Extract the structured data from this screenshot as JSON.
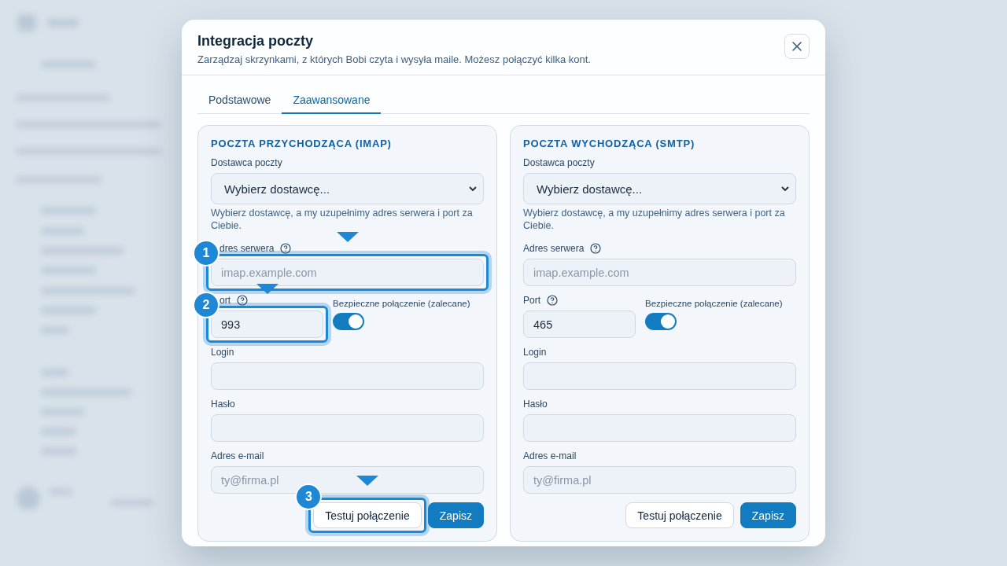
{
  "dialog": {
    "title": "Integracja poczty",
    "subtitle": "Zarządzaj skrzynkami, z których Bobi czyta i wysyła maile. Możesz połączyć kilka kont."
  },
  "tabs": [
    {
      "label": "Podstawowe",
      "selected": false
    },
    {
      "label": "Zaawansowane",
      "selected": true
    }
  ],
  "panels": [
    {
      "title": "POCZTA PRZYCHODZĄCA (IMAP)",
      "fields": [
        {
          "kind": "select",
          "label": "Dostawca poczty",
          "value": "Wybierz dostawcę...",
          "hint": "Wybierz dostawcę, a my uzupełnimy adres serwera i port za Ciebie."
        },
        {
          "kind": "input",
          "label": "dres serwera",
          "help": true,
          "placeholder": "imap.example.com",
          "tour_step": "1"
        },
        {
          "kind": "port",
          "label": "ort",
          "help": true,
          "value": "993",
          "tour_step": "2",
          "toggle": {
            "label": "Bezpieczne połączenie (zalecane)",
            "on": true
          }
        },
        {
          "kind": "input",
          "label": "Login",
          "help": false
        },
        {
          "kind": "input",
          "label": "Hasło",
          "help": false
        },
        {
          "kind": "input",
          "label": "Adres e-mail",
          "help": false,
          "placeholder": "ty@firma.pl"
        }
      ],
      "buttons": [
        {
          "label": "Testuj połączenie",
          "kind": "secondary",
          "tour_step": "3"
        },
        {
          "label": "Zapisz",
          "kind": "primary"
        }
      ]
    },
    {
      "title": "POCZTA WYCHODZĄCA (SMTP)",
      "fields": [
        {
          "kind": "select",
          "label": "Dostawca poczty",
          "value": "Wybierz dostawcę...",
          "hint": "Wybierz dostawcę, a my uzupełnimy adres serwera i port za Ciebie."
        },
        {
          "kind": "input",
          "label": "Adres serwera",
          "help": true,
          "placeholder": "imap.example.com"
        },
        {
          "kind": "port",
          "label": "Port",
          "help": true,
          "value": "465",
          "toggle": {
            "label": "Bezpieczne połączenie (zalecane)",
            "on": true
          }
        },
        {
          "kind": "input",
          "label": "Login",
          "help": false
        },
        {
          "kind": "input",
          "label": "Hasło",
          "help": false
        },
        {
          "kind": "input",
          "label": "Adres e-mail",
          "help": false,
          "placeholder": "ty@firma.pl"
        }
      ],
      "buttons": [
        {
          "label": "Testuj połączenie",
          "kind": "secondary"
        },
        {
          "label": "Zapisz",
          "kind": "primary"
        }
      ]
    }
  ]
}
